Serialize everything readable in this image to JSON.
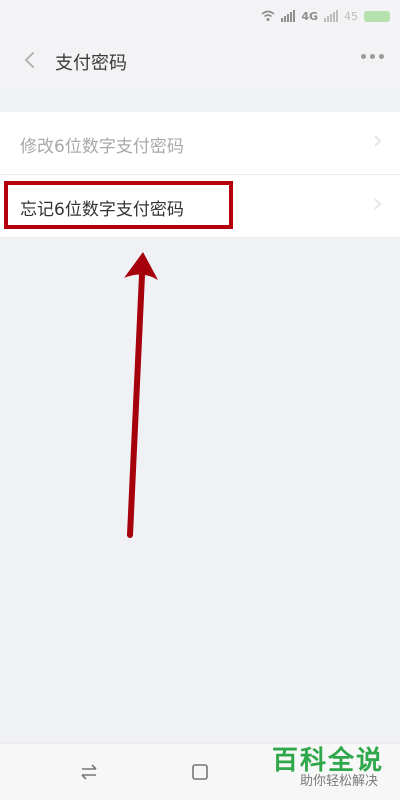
{
  "status_bar": {
    "time": "",
    "network": "4G",
    "battery": "45"
  },
  "header": {
    "title": "支付密码"
  },
  "menu": {
    "items": [
      {
        "label": "修改6位数字支付密码"
      },
      {
        "label": "忘记6位数字支付密码"
      }
    ]
  },
  "watermark": {
    "brand": "百科全说",
    "tagline": "助你轻松解决",
    "brand_color": "#2ea84a"
  },
  "annotation": {
    "highlight_color": "#b3000c",
    "arrow_color": "#a5000b"
  }
}
